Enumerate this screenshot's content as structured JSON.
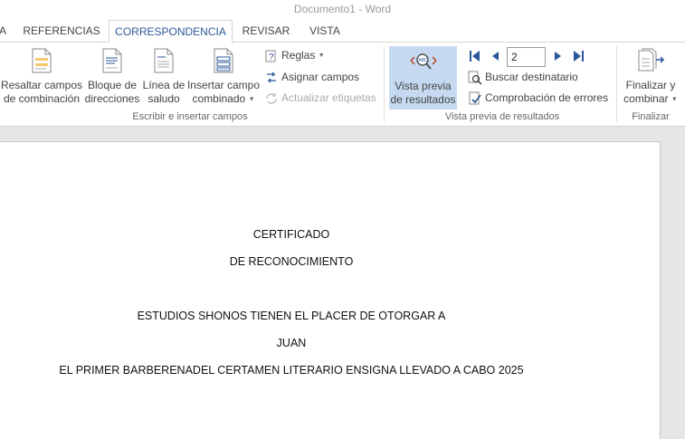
{
  "window": {
    "title": "Documento1 - Word"
  },
  "tabs": {
    "partial": "A",
    "referencias": "REFERENCIAS",
    "correspondencia": "CORRESPONDENCIA",
    "revisar": "REVISAR",
    "vista": "VISTA",
    "active": "CORRESPONDENCIA"
  },
  "ribbon": {
    "write_group": {
      "label": "Escribir e insertar campos",
      "resaltar": [
        "Resaltar campos",
        "de combinación"
      ],
      "bloque": [
        "Bloque de",
        "direcciones"
      ],
      "linea": [
        "Línea de",
        "saludo"
      ],
      "insertar": [
        "Insertar campo",
        "combinado"
      ],
      "reglas": "Reglas",
      "asignar": "Asignar campos",
      "actualizar": "Actualizar etiquetas"
    },
    "preview_group": {
      "label": "Vista previa de resultados",
      "vista_previa": [
        "Vista previa",
        "de resultados"
      ],
      "record_number": "2",
      "buscar": "Buscar destinatario",
      "comprobacion": "Comprobación de errores"
    },
    "finish_group": {
      "label": "Finalizar",
      "finalizar": [
        "Finalizar y",
        "combinar"
      ]
    }
  },
  "document": {
    "lines": [
      "CERTIFICADO",
      "DE RECONOCIMIENTO",
      "ESTUDIOS SHONOS TIENEN EL PLACER DE OTORGAR A",
      "JUAN",
      "EL PRIMER BARBERENADEL CERTAMEN LITERARIO ENSIGNA LLEVADO A CABO 2025"
    ]
  },
  "colors": {
    "accent": "#2b579a",
    "active_button_bg": "#c5daf0"
  }
}
